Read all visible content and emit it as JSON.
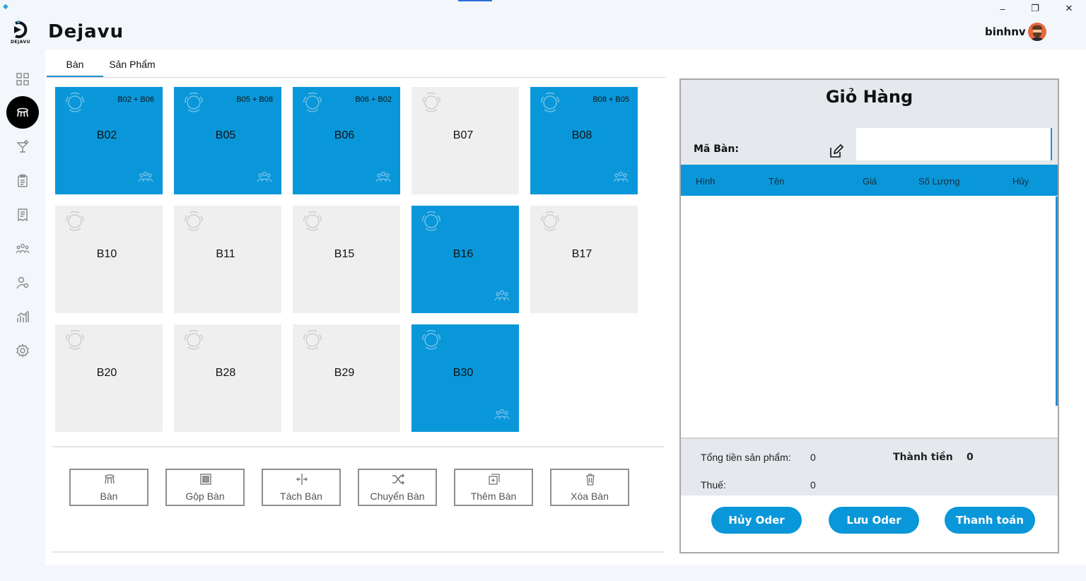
{
  "window": {
    "minimize": "–",
    "maximize": "❐",
    "close": "✕"
  },
  "header": {
    "logo_text": "DEJAVU",
    "app_title": "Dejavu",
    "username": "binhnv"
  },
  "sidebar": {
    "items": [
      {
        "icon": "dashboard-icon"
      },
      {
        "icon": "table-icon",
        "active": true
      },
      {
        "icon": "drink-icon"
      },
      {
        "icon": "clipboard-icon"
      },
      {
        "icon": "receipt-icon"
      },
      {
        "icon": "staff-icon"
      },
      {
        "icon": "user-icon"
      },
      {
        "icon": "stats-icon"
      },
      {
        "icon": "settings-icon"
      }
    ]
  },
  "tabs": [
    {
      "label": "Bàn",
      "active": true
    },
    {
      "label": "Sản Phẩm",
      "active": false
    }
  ],
  "tables": [
    {
      "name": "B02",
      "merge": "B02 + B06",
      "busy": true
    },
    {
      "name": "B05",
      "merge": "B05 + B08",
      "busy": true
    },
    {
      "name": "B06",
      "merge": "B06 + B02",
      "busy": true
    },
    {
      "name": "B07",
      "merge": "",
      "busy": false
    },
    {
      "name": "B08",
      "merge": "B08 + B05",
      "busy": true
    },
    {
      "name": "B10",
      "merge": "",
      "busy": false
    },
    {
      "name": "B11",
      "merge": "",
      "busy": false
    },
    {
      "name": "B15",
      "merge": "",
      "busy": false
    },
    {
      "name": "B16",
      "merge": "",
      "busy": true
    },
    {
      "name": "B17",
      "merge": "",
      "busy": false
    },
    {
      "name": "B20",
      "merge": "",
      "busy": false
    },
    {
      "name": "B28",
      "merge": "",
      "busy": false
    },
    {
      "name": "B29",
      "merge": "",
      "busy": false
    },
    {
      "name": "B30",
      "merge": "",
      "busy": true
    }
  ],
  "actions": [
    {
      "label": "Bàn",
      "icon": "table-icon"
    },
    {
      "label": "Gộp Bàn",
      "icon": "merge-icon"
    },
    {
      "label": "Tách Bàn",
      "icon": "split-icon"
    },
    {
      "label": "Chuyển Bàn",
      "icon": "shuffle-icon"
    },
    {
      "label": "Thêm Bàn",
      "icon": "add-icon"
    },
    {
      "label": "Xóa Bàn",
      "icon": "trash-icon"
    }
  ],
  "cart": {
    "title": "Giỏ Hàng",
    "ma_ban_label": "Mã Bàn:",
    "ma_ban_value": "",
    "columns": {
      "hinh": "Hình",
      "ten": "Tên",
      "gia": "Giá",
      "so_luong": "Số Lượng",
      "huy": "Hủy"
    },
    "tong_tien_label": "Tổng tiền sản phẩm:",
    "tong_tien_value": "0",
    "thanh_tien_label": "Thành tiền",
    "thanh_tien_value": "0",
    "thue_label": "Thuế:",
    "thue_value": "0",
    "buttons": {
      "huy": "Hủy Oder",
      "luu": "Lưu Oder",
      "thanh_toan": "Thanh toán"
    }
  },
  "colors": {
    "accent": "#0a97d9",
    "free_table": "#efefef",
    "sidebar_active": "#000000"
  }
}
